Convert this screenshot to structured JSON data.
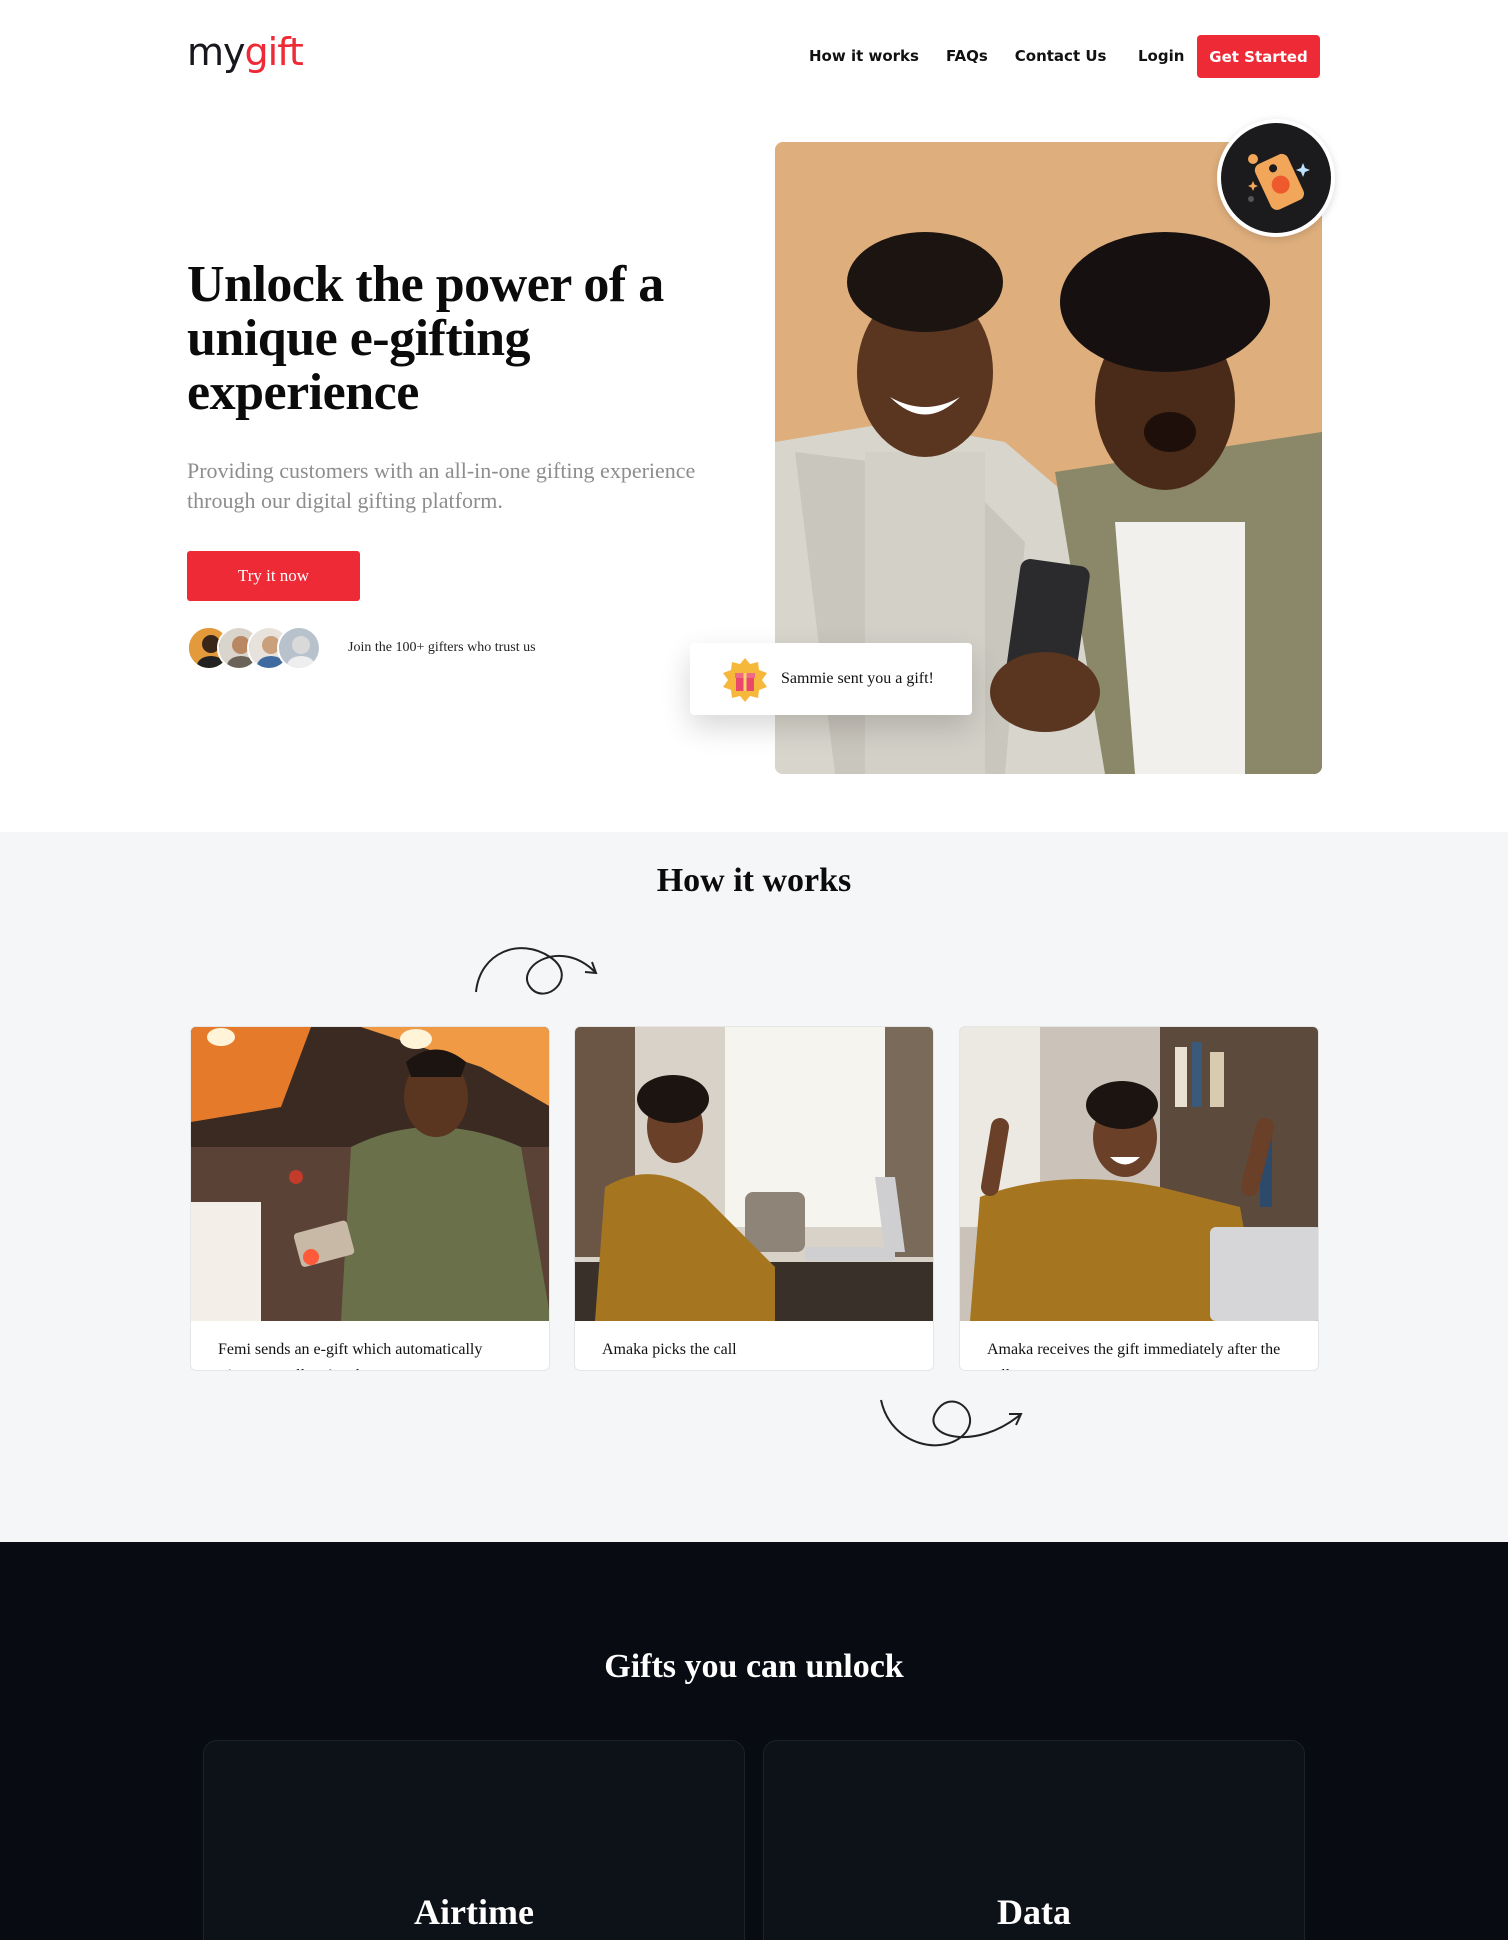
{
  "brand": {
    "logo_part1": "my",
    "logo_part2": "gift"
  },
  "nav": {
    "links": [
      "How it works",
      "FAQs",
      "Contact Us"
    ],
    "login": "Login",
    "get_started": "Get Started"
  },
  "hero": {
    "title": "Unlock the power of a unique e-gifting experience",
    "subtitle": "Providing customers with an all-in-one gifting experience through our digital gifting platform.",
    "cta": "Try it now",
    "trust_text": "Join the 100+ gifters who trust us",
    "notification": "Sammie sent you a gift!"
  },
  "how": {
    "title": "How it works",
    "steps": [
      {
        "caption": "Femi sends an e-gift which automatically triggers a call to Amaka"
      },
      {
        "caption": "Amaka picks the call"
      },
      {
        "caption": "Amaka receives the gift immediately after the call"
      }
    ]
  },
  "gifts": {
    "title": "Gifts you can unlock",
    "items": [
      "Airtime",
      "Data"
    ]
  },
  "colors": {
    "accent": "#ee2a36",
    "dark": "#080b12",
    "section_bg": "#f5f6f8"
  }
}
